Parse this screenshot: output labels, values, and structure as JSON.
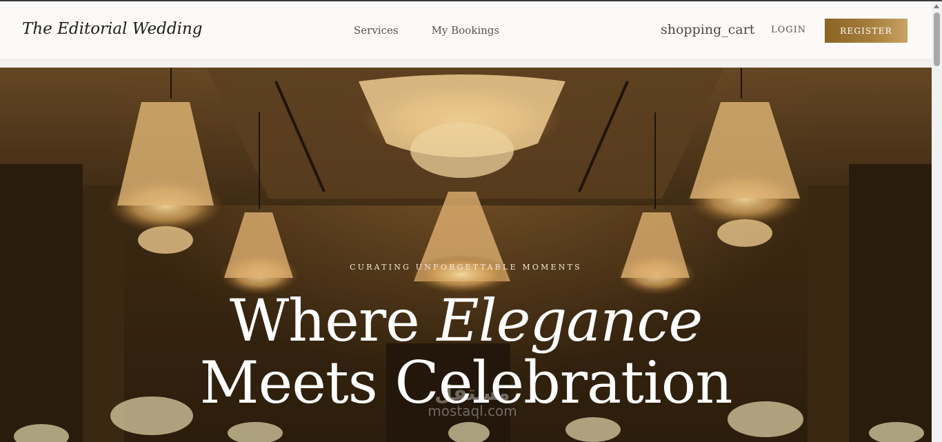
{
  "brand": {
    "name": "The Editorial Wedding"
  },
  "nav": {
    "items": [
      {
        "label": "Services"
      },
      {
        "label": "My Bookings"
      }
    ]
  },
  "header_actions": {
    "cart_icon_text": "shopping_cart",
    "login_label": "LOGIN",
    "register_label": "REGISTER"
  },
  "hero": {
    "eyebrow": "CURATING UNFORGETTABLE MOMENTS",
    "headline_part1": "Where ",
    "headline_emphasis": "Elegance",
    "headline_line2": "Meets Celebration"
  },
  "watermark": {
    "logo_text": "مستقل",
    "domain": "mostaql.com"
  },
  "colors": {
    "accent_gold": "#a67e3c",
    "header_bg": "#fbfaf8",
    "hero_brown": "#3a2711"
  }
}
